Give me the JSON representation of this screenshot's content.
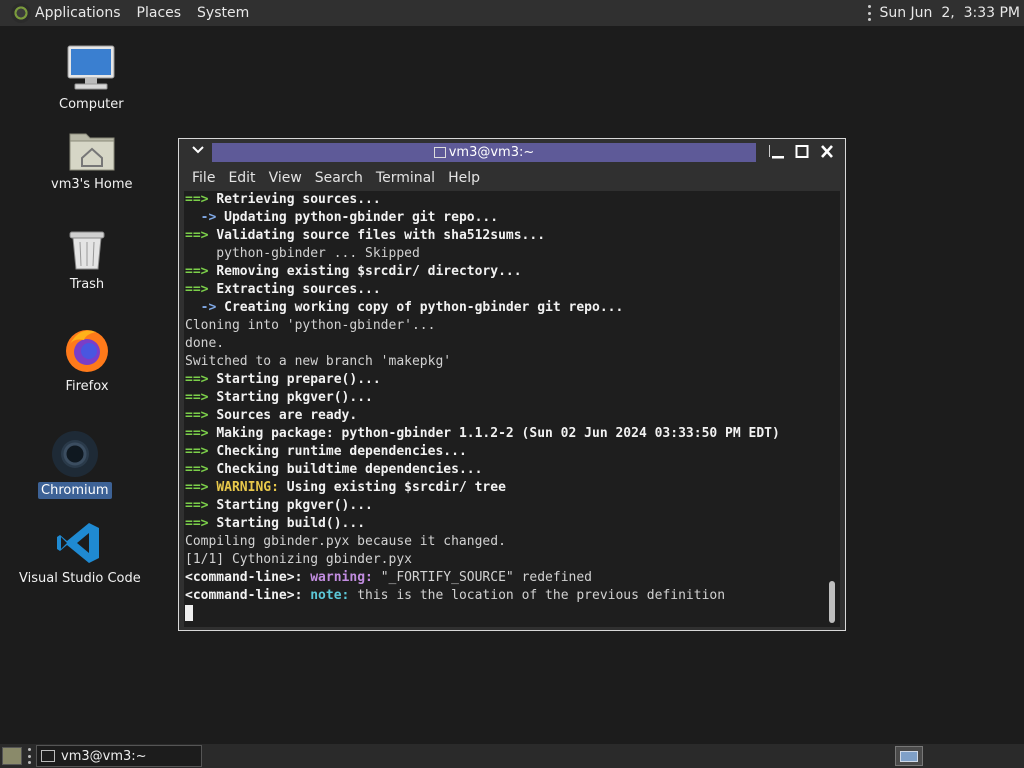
{
  "top_panel": {
    "applications": "Applications",
    "places": "Places",
    "system": "System",
    "clock": "Sun Jun  2,  3:33 PM"
  },
  "desktop_icons": {
    "computer": "Computer",
    "home": "vm3's Home",
    "trash": "Trash",
    "firefox": "Firefox",
    "chromium": "Chromium",
    "vscode": "Visual Studio Code"
  },
  "terminal": {
    "title": "vm3@vm3:~",
    "menu": [
      "File",
      "Edit",
      "View",
      "Search",
      "Terminal",
      "Help"
    ],
    "lines": [
      [
        {
          "t": "==> ",
          "c": "g"
        },
        {
          "t": "Retrieving sources...",
          "c": "b"
        }
      ],
      [
        {
          "t": "  -> ",
          "c": "bl"
        },
        {
          "t": "Updating python-gbinder git repo...",
          "c": "b"
        }
      ],
      [
        {
          "t": "==> ",
          "c": "g"
        },
        {
          "t": "Validating source files with sha512sums...",
          "c": "b"
        }
      ],
      [
        {
          "t": "    python-gbinder ... Skipped",
          "c": ""
        }
      ],
      [
        {
          "t": "==> ",
          "c": "g"
        },
        {
          "t": "Removing existing $srcdir/ directory...",
          "c": "b"
        }
      ],
      [
        {
          "t": "==> ",
          "c": "g"
        },
        {
          "t": "Extracting sources...",
          "c": "b"
        }
      ],
      [
        {
          "t": "  -> ",
          "c": "bl"
        },
        {
          "t": "Creating working copy of python-gbinder git repo...",
          "c": "b"
        }
      ],
      [
        {
          "t": "Cloning into 'python-gbinder'...",
          "c": ""
        }
      ],
      [
        {
          "t": "done.",
          "c": ""
        }
      ],
      [
        {
          "t": "Switched to a new branch 'makepkg'",
          "c": ""
        }
      ],
      [
        {
          "t": "==> ",
          "c": "g"
        },
        {
          "t": "Starting prepare()...",
          "c": "b"
        }
      ],
      [
        {
          "t": "==> ",
          "c": "g"
        },
        {
          "t": "Starting pkgver()...",
          "c": "b"
        }
      ],
      [
        {
          "t": "==> ",
          "c": "g"
        },
        {
          "t": "Sources are ready.",
          "c": "b"
        }
      ],
      [
        {
          "t": "==> ",
          "c": "g"
        },
        {
          "t": "Making package: python-gbinder 1.1.2-2 (Sun 02 Jun 2024 03:33:50 PM EDT)",
          "c": "b"
        }
      ],
      [
        {
          "t": "==> ",
          "c": "g"
        },
        {
          "t": "Checking runtime dependencies...",
          "c": "b"
        }
      ],
      [
        {
          "t": "==> ",
          "c": "g"
        },
        {
          "t": "Checking buildtime dependencies...",
          "c": "b"
        }
      ],
      [
        {
          "t": "==> ",
          "c": "g"
        },
        {
          "t": "WARNING:",
          "c": "y"
        },
        {
          "t": " Using existing $srcdir/ tree",
          "c": "b"
        }
      ],
      [
        {
          "t": "==> ",
          "c": "g"
        },
        {
          "t": "Starting pkgver()...",
          "c": "b"
        }
      ],
      [
        {
          "t": "==> ",
          "c": "g"
        },
        {
          "t": "Starting build()...",
          "c": "b"
        }
      ],
      [
        {
          "t": "Compiling gbinder.pyx because it changed.",
          "c": ""
        }
      ],
      [
        {
          "t": "[1/1] Cythonizing gbinder.pyx",
          "c": ""
        }
      ],
      [
        {
          "t": "<command-line>:",
          "c": "b"
        },
        {
          "t": " warning: ",
          "c": "m"
        },
        {
          "t": "\"_FORTIFY_SOURCE\" redefined",
          "c": ""
        }
      ],
      [
        {
          "t": "<command-line>:",
          "c": "b"
        },
        {
          "t": " note: ",
          "c": "c"
        },
        {
          "t": "this is the location of the previous definition",
          "c": ""
        }
      ]
    ]
  },
  "taskbar": {
    "window_label": "vm3@vm3:~"
  }
}
